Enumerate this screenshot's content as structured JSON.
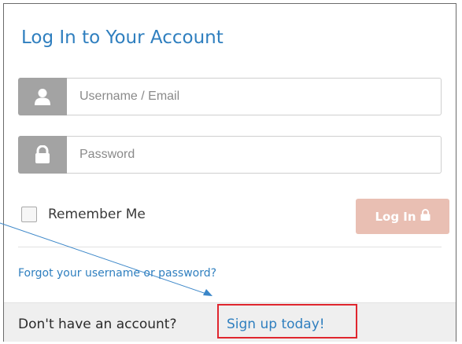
{
  "form": {
    "title": "Log In to Your Account",
    "username": {
      "placeholder": "Username / Email",
      "value": "",
      "icon": "user-icon"
    },
    "password": {
      "placeholder": "Password",
      "value": "",
      "icon": "lock-icon"
    },
    "remember_label": "Remember Me",
    "remember_checked": false,
    "login_label": "Log In",
    "login_icon": "lock-icon",
    "forgot_link": "Forgot your username or password?"
  },
  "footer": {
    "prompt": "Don't have an account?",
    "signup_link": "Sign up today!"
  },
  "colors": {
    "accent": "#2f7fbf",
    "login_button": "#e9bfb3",
    "icon_addon": "#a3a3a3",
    "highlight": "#e0262e",
    "annotation_arrow": "#3a86c8"
  }
}
